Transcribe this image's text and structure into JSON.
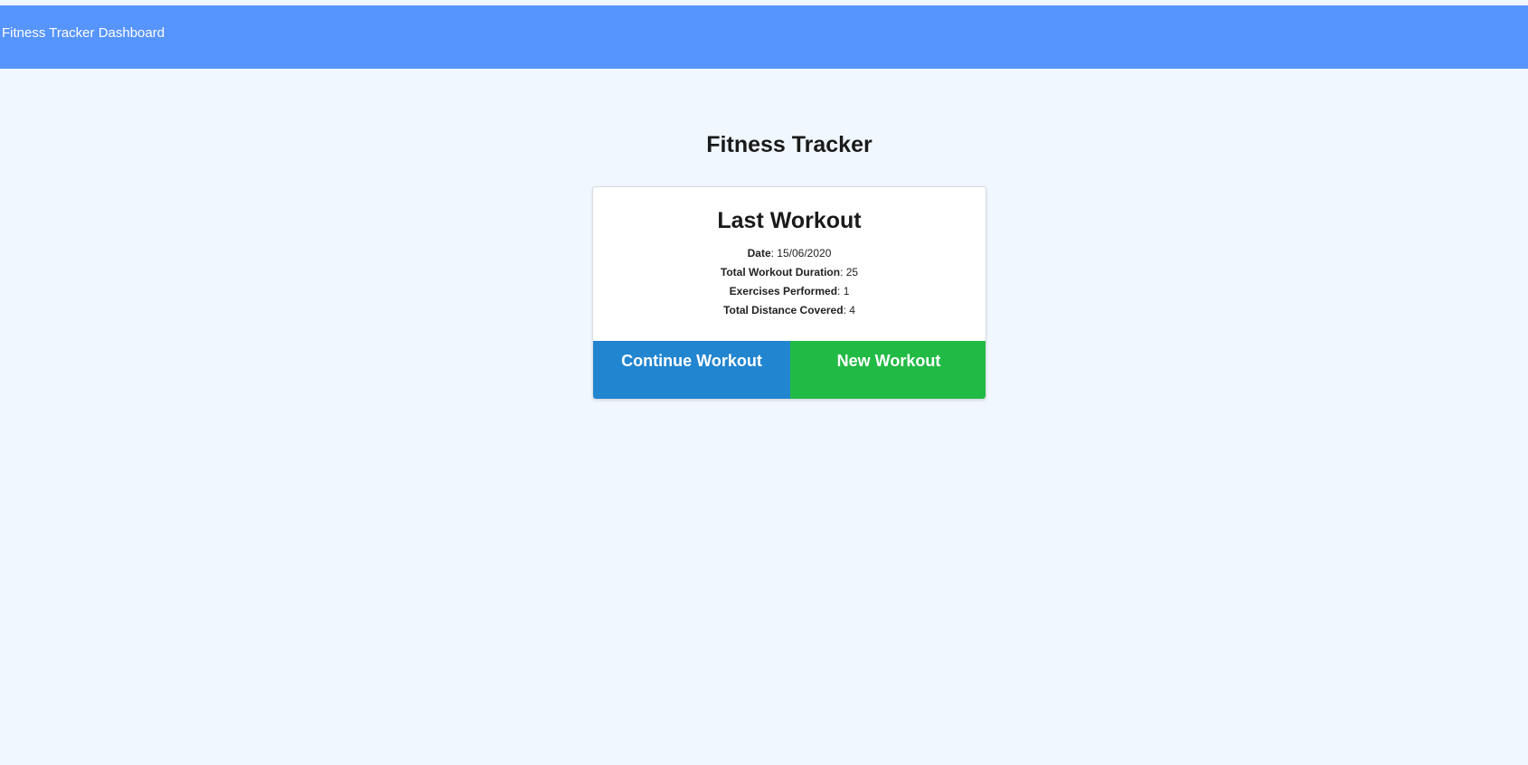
{
  "navbar": {
    "brand": "Fitness Tracker Dashboard",
    "color": "#5694fe"
  },
  "page": {
    "title": "Fitness Tracker"
  },
  "last_workout": {
    "title": "Last Workout",
    "stats": [
      {
        "label": "Date",
        "value": ": 15/06/2020"
      },
      {
        "label": "Total Workout Duration",
        "value": ": 25"
      },
      {
        "label": "Exercises Performed",
        "value": ": 1"
      },
      {
        "label": "Total Distance Covered",
        "value": ": 4"
      }
    ]
  },
  "actions": {
    "continue_label": "Continue Workout",
    "continue_color": "#2185d0",
    "new_label": "New Workout",
    "new_color": "#21ba45"
  }
}
